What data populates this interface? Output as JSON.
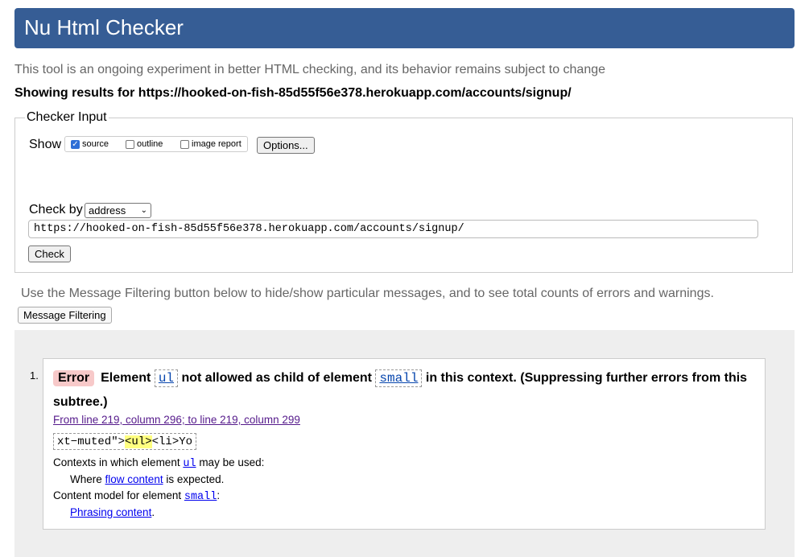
{
  "banner": {
    "title": "Nu Html Checker"
  },
  "intro_text": "This tool is an ongoing experiment in better HTML checking, and its behavior remains subject to change",
  "results_for": "Showing results for https://hooked-on-fish-85d55f56e378.herokuapp.com/accounts/signup/",
  "checker": {
    "legend": "Checker Input",
    "show_label": "Show",
    "show_source": {
      "label": "source",
      "checked": true
    },
    "show_outline": {
      "label": "outline",
      "checked": false
    },
    "show_image_report": {
      "label": "image report",
      "checked": false
    },
    "options_button": "Options...",
    "check_by_label": "Check by",
    "check_by_value": "address",
    "url_value": "https://hooked-on-fish-85d55f56e378.herokuapp.com/accounts/signup/",
    "check_button": "Check"
  },
  "filter": {
    "help_text": "Use the Message Filtering button below to hide/show particular messages, and to see total counts of errors and warnings.",
    "button_label": "Message Filtering"
  },
  "messages": [
    {
      "number": "1.",
      "type": "Error",
      "text_1": "Element",
      "code_1": "ul",
      "text_2": "not allowed as child of element",
      "code_2": "small",
      "text_3": "in this context. (Suppressing further errors from this subtree.)",
      "location": "From line 219, column 296; to line 219, column 299",
      "extract_before": "xt−muted\">",
      "extract_highlight": "<ul>",
      "extract_after": "<li>Yo",
      "ctx1_text_1": "Contexts in which element",
      "ctx1_code": "ul",
      "ctx1_text_2": "may be used:",
      "ctx2_text_1": "Where",
      "ctx2_link": "flow content",
      "ctx2_text_2": "is expected.",
      "ctx3_text_1": "Content model for element",
      "ctx3_code": "small",
      "ctx3_text_2": ":",
      "ctx4_link": "Phrasing content",
      "ctx4_text_2": "."
    }
  ]
}
